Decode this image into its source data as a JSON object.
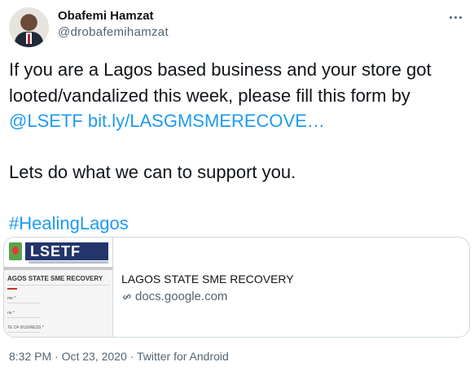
{
  "author": {
    "name": "Obafemi Hamzat",
    "handle": "@drobafemihamzat"
  },
  "tweet": {
    "line1": "If you are a Lagos based business and your store got",
    "line2": "looted/vandalized this week, please fill this form by",
    "mention": "@LSETF",
    "url": "bit.ly/LASGMSMERECOVE…",
    "line4": "Lets do what we can to support you.",
    "hashtag": "#HealingLagos"
  },
  "card": {
    "thumb_logo": "LSETF",
    "thumb_title": "AGOS STATE SME RECOVERY",
    "thumb_field1": "me *",
    "thumb_field2": "ne *",
    "thumb_field3": "TE OF BUSINESS *",
    "title": "LAGOS STATE SME RECOVERY",
    "domain": "docs.google.com",
    "icon": "link-icon"
  },
  "meta": {
    "time": "8:32 PM",
    "sep1": " · ",
    "date": "Oct 23, 2020",
    "sep2": " · ",
    "source": "Twitter for Android"
  },
  "colors": {
    "link": "#1d9bf0",
    "secondary": "#536471",
    "text": "#0f1419",
    "border": "#cfd9de"
  }
}
